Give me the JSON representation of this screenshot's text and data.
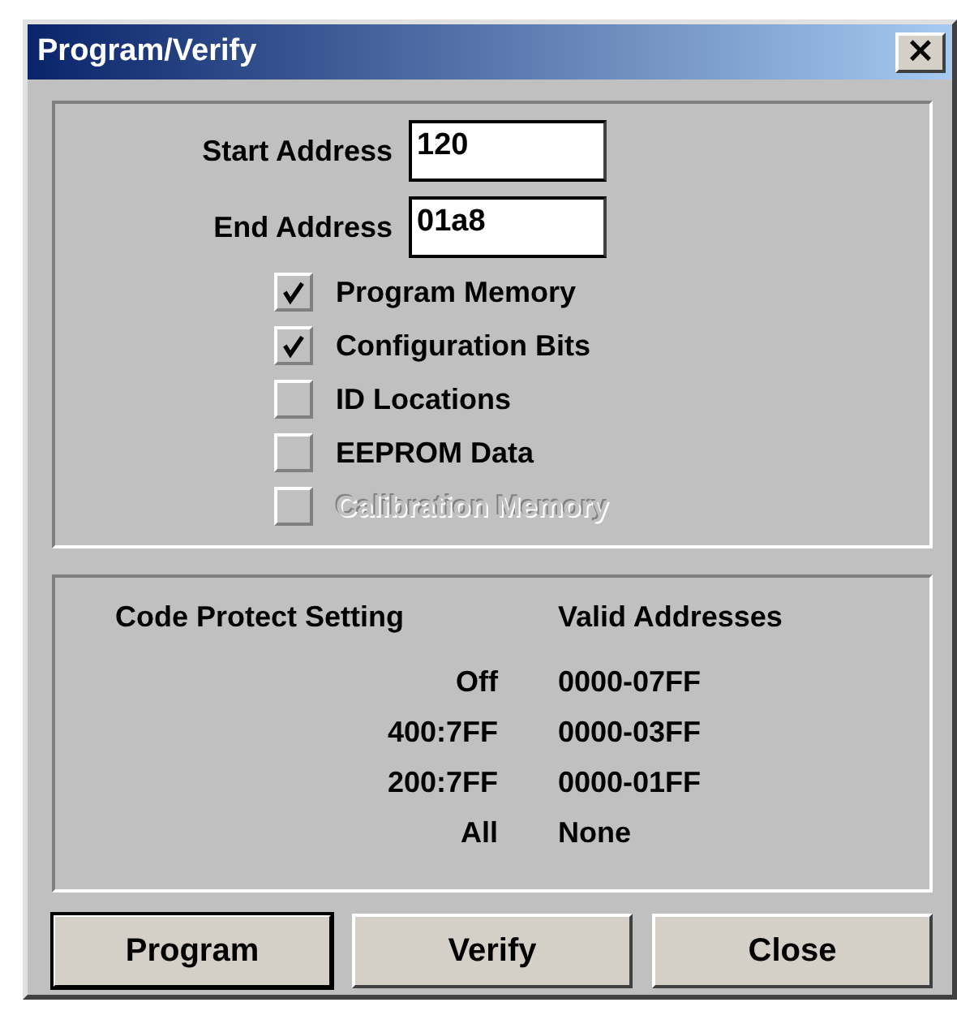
{
  "window": {
    "title": "Program/Verify",
    "close_label": "×"
  },
  "address_fields": [
    {
      "label": "Start Address",
      "value": "120"
    },
    {
      "label": "End Address",
      "value": "01a8"
    }
  ],
  "options": [
    {
      "label": "Program Memory",
      "checked": true,
      "disabled": false
    },
    {
      "label": "Configuration Bits",
      "checked": true,
      "disabled": false
    },
    {
      "label": "ID Locations",
      "checked": false,
      "disabled": false
    },
    {
      "label": "EEPROM Data",
      "checked": false,
      "disabled": false
    },
    {
      "label": "Calibration Memory",
      "checked": false,
      "disabled": true
    }
  ],
  "table": {
    "columns": [
      "Code Protect Setting",
      "Valid Addresses"
    ],
    "rows": [
      [
        "Off",
        "0000-07FF"
      ],
      [
        "400:7FF",
        "0000-03FF"
      ],
      [
        "200:7FF",
        "0000-01FF"
      ],
      [
        "All",
        "None"
      ]
    ]
  },
  "buttons": [
    {
      "label": "Program",
      "default": true
    },
    {
      "label": "Verify",
      "default": false
    },
    {
      "label": "Close",
      "default": false
    }
  ]
}
